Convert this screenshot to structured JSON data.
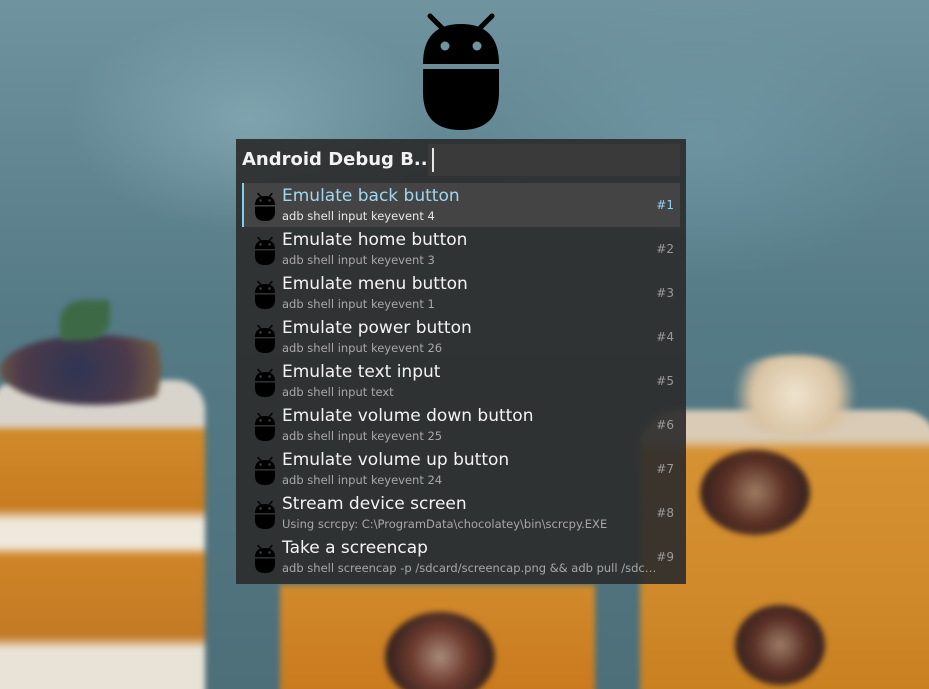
{
  "launcher": {
    "plugin_title": "Android Debug B...",
    "query_value": "",
    "accent_color": "#7fd0ee"
  },
  "logo": {
    "icon": "android-robot-icon"
  },
  "results": [
    {
      "title": "Emulate back button",
      "subtitle": "adb shell input keyevent 4",
      "number": "#1",
      "selected": true,
      "icon": "android-icon"
    },
    {
      "title": "Emulate home button",
      "subtitle": "adb shell input keyevent 3",
      "number": "#2",
      "icon": "android-icon"
    },
    {
      "title": "Emulate menu button",
      "subtitle": "adb shell input keyevent 1",
      "number": "#3",
      "icon": "android-icon"
    },
    {
      "title": "Emulate power button",
      "subtitle": "adb shell input keyevent 26",
      "number": "#4",
      "icon": "android-icon"
    },
    {
      "title": "Emulate text input",
      "subtitle": "adb shell input text",
      "number": "#5",
      "icon": "android-icon"
    },
    {
      "title": "Emulate volume down button",
      "subtitle": "adb shell input keyevent 25",
      "number": "#6",
      "icon": "android-icon"
    },
    {
      "title": "Emulate volume up button",
      "subtitle": "adb shell input keyevent 24",
      "number": "#7",
      "icon": "android-icon"
    },
    {
      "title": "Stream device screen",
      "subtitle": "Using scrcpy: C:\\ProgramData\\chocolatey\\bin\\scrcpy.EXE",
      "number": "#8",
      "icon": "android-icon"
    },
    {
      "title": "Take a screencap",
      "subtitle": "adb shell screencap -p /sdcard/screencap.png && adb pull /sdcard...",
      "number": "#9",
      "icon": "android-icon"
    }
  ]
}
